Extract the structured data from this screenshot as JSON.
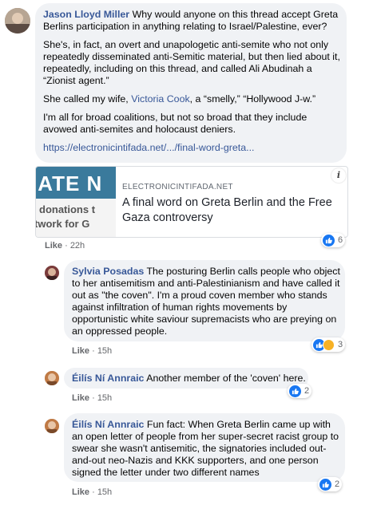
{
  "comments": [
    {
      "author": "Jason Lloyd Miller",
      "paragraphs": [
        "Why would anyone on this thread accept Greta Berlins participation in anything relating to Israel/Palestine, ever?",
        "She's, in fact, an overt and unapologetic anti-semite who not only repeatedly disseminated anti-Semitic material, but then lied about it, repeatedly, including on this thread, and called Ali Abudinah a “Zionist agent.”",
        "She called my wife,",
        "Victoria Cook",
        ", a “smelly,” “Hollywood J-w.”",
        "I'm all for broad coalitions, but not so broad that they include avowed anti-semites and holocaust deniers."
      ],
      "url_text": "https://electronicintifada.net/.../final-word-greta...",
      "like": "Like",
      "time": "22h",
      "reaction_count": "6"
    },
    {
      "author": "Sylvia Posadas",
      "text": "The posturing Berlin calls people who object to her antisemitism and anti-Palestinianism and have called it out as \"the coven\". I'm a proud coven member who stands against infiltration of human rights movements by opportunistic white saviour supremacists who are preying on an oppressed people.",
      "like": "Like",
      "time": "15h",
      "reaction_count": "3"
    },
    {
      "author": "Éilís Ní Annraic",
      "text": "Another member of the 'coven' here.",
      "like": "Like",
      "time": "15h",
      "reaction_count": "2"
    },
    {
      "author": "Éilís Ní Annraic",
      "text": "Fun fact: When Greta Berlin came up with an open letter of people from her super-secret racist group to swear she wasn't antisemitic, the signatories included out-and-out neo-Nazis and KKK supporters, and one person signed the letter under two different names",
      "like": "Like",
      "time": "15h",
      "reaction_count": "2"
    }
  ],
  "link_preview": {
    "thumb_big": "IATE N",
    "thumb_line1": "donations t",
    "thumb_line2": "twork for G",
    "domain": "ELECTRONICINTIFADA.NET",
    "title": "A final word on Greta Berlin and the Free Gaza controversy",
    "info": "i"
  },
  "colors": {
    "link": "#385898",
    "bubble": "#f0f2f5",
    "like_blue": "#1877f2",
    "thumb_bg": "#3a7a9c"
  },
  "icons": {
    "reaction": "thumbs-up-icon",
    "haha": "haha-icon",
    "info": "info-icon"
  }
}
